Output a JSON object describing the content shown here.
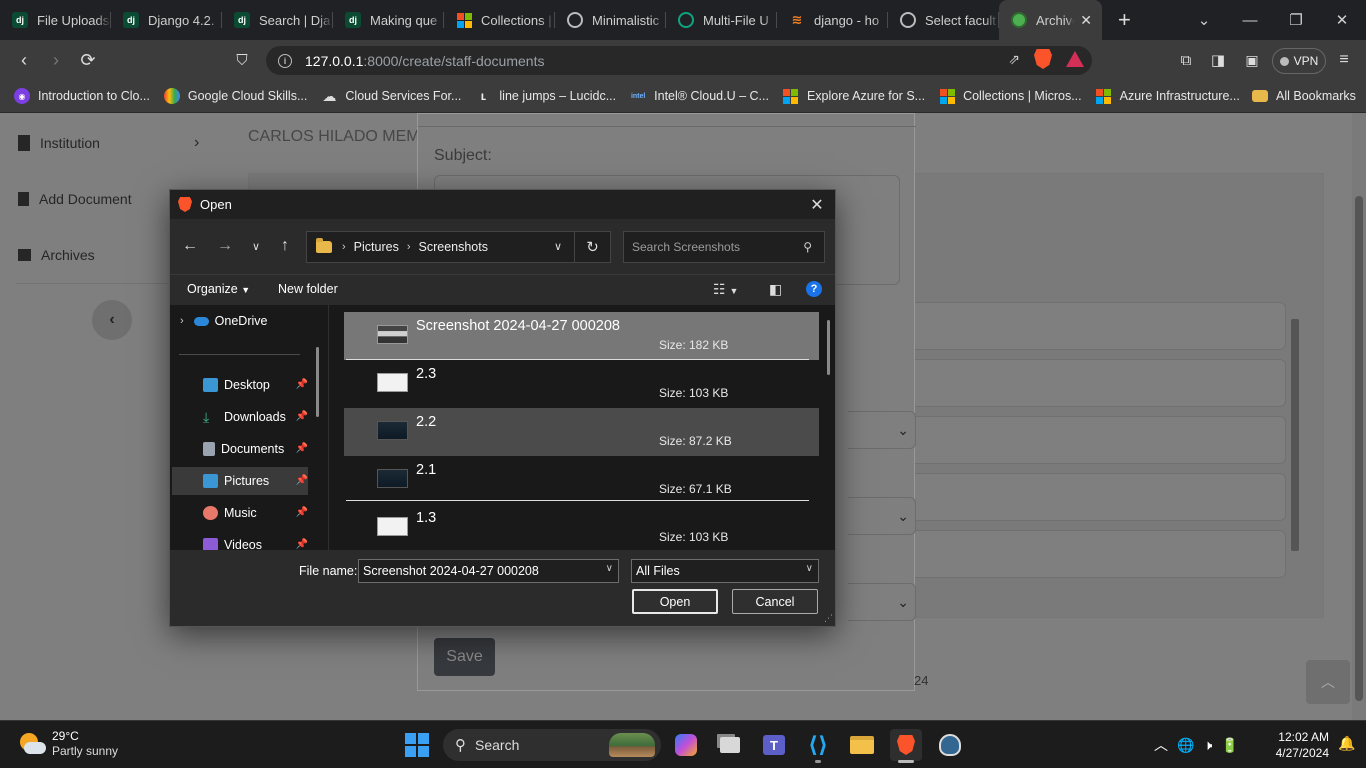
{
  "browser": {
    "tabs": [
      {
        "title": "File Uploads",
        "favicon": "django-icon",
        "color": "#0c4b33"
      },
      {
        "title": "Django 4.2.",
        "favicon": "django-icon",
        "color": "#0c4b33"
      },
      {
        "title": "Search | Dja",
        "favicon": "django-icon",
        "color": "#0c4b33"
      },
      {
        "title": "Making que",
        "favicon": "django-icon",
        "color": "#0c4b33"
      },
      {
        "title": "Collections |",
        "favicon": "microsoft-icon",
        "color": "#f25022"
      },
      {
        "title": "Minimalistic",
        "favicon": "globe-icon",
        "color": "#888888"
      },
      {
        "title": "Multi-File U",
        "favicon": "chatgpt-icon",
        "color": "#10a37f"
      },
      {
        "title": "django - ho",
        "favicon": "stackoverflow-icon",
        "color": "#f48024"
      },
      {
        "title": "Select facult",
        "favicon": "globe-icon",
        "color": "#888888"
      }
    ],
    "active_tab": {
      "title": "Archive",
      "favicon": "app-icon"
    },
    "url_host": "127.0.0.1",
    "url_rest": ":8000/create/staff-documents",
    "vpn_label": "VPN",
    "bookmarks": [
      {
        "label": "Introduction to Clo...",
        "icon": "course-icon",
        "color": "#7b3fe4"
      },
      {
        "label": "Google Cloud Skills...",
        "icon": "google-cloud-icon",
        "color": "#4285f4"
      },
      {
        "label": "Cloud Services For...",
        "icon": "cloud-icon",
        "color": "#555555"
      },
      {
        "label": "line jumps – Lucidc...",
        "icon": "lucid-icon",
        "color": "#3a3a3a"
      },
      {
        "label": "Intel® Cloud.U – C...",
        "icon": "intel-icon",
        "color": "#0071c5"
      },
      {
        "label": "Explore Azure for S...",
        "icon": "microsoft-icon",
        "color": "#f25022"
      },
      {
        "label": "Collections | Micros...",
        "icon": "microsoft-icon",
        "color": "#f25022"
      },
      {
        "label": "Azure Infrastructure...",
        "icon": "microsoft-icon",
        "color": "#f25022"
      }
    ],
    "more_bookmarks": "»",
    "all_bookmarks": "All Bookmarks"
  },
  "page": {
    "sidebar": [
      {
        "label": "Institution",
        "icon": "building-icon"
      },
      {
        "label": "Add Document",
        "icon": "file-icon"
      },
      {
        "label": "Archives",
        "icon": "archive-icon"
      }
    ],
    "heading": "CARLOS HILADO MEM",
    "subject_label": "Subject:",
    "save_label": "Save",
    "year_fragment": "24"
  },
  "dialog": {
    "title": "Open",
    "breadcrumbs": [
      "Pictures",
      "Screenshots"
    ],
    "search_placeholder": "Search Screenshots",
    "organize_label": "Organize",
    "new_folder_label": "New folder",
    "help_label": "?",
    "nav_items": [
      {
        "label": "OneDrive",
        "icon": "onedrive-icon",
        "color": "#2b88d8",
        "pinned": false
      },
      {
        "label": "Desktop",
        "icon": "desktop-icon",
        "color": "#3b97d3",
        "pinned": true
      },
      {
        "label": "Downloads",
        "icon": "download-icon",
        "color": "#3fb68b",
        "pinned": true
      },
      {
        "label": "Documents",
        "icon": "document-icon",
        "color": "#9aa4b1",
        "pinned": true
      },
      {
        "label": "Pictures",
        "icon": "pictures-icon",
        "color": "#3b97d3",
        "pinned": true
      },
      {
        "label": "Music",
        "icon": "music-icon",
        "color": "#e8786a",
        "pinned": true
      },
      {
        "label": "Videos",
        "icon": "videos-icon",
        "color": "#8e5bd6",
        "pinned": true
      }
    ],
    "files": [
      {
        "name": "Screenshot 2024-04-27 000208",
        "size": "Size: 182 KB",
        "state": "selected"
      },
      {
        "name": "2.3",
        "size": "Size: 103 KB",
        "state": ""
      },
      {
        "name": "2.2",
        "size": "Size: 87.2 KB",
        "state": "hover"
      },
      {
        "name": "2.1",
        "size": "Size: 67.1 KB",
        "state": ""
      },
      {
        "name": "1.3",
        "size": "Size: 103 KB",
        "state": ""
      }
    ],
    "file_name_label": "File name:",
    "file_name_value": "Screenshot 2024-04-27 000208",
    "file_type": "All Files",
    "open_label": "Open",
    "cancel_label": "Cancel"
  },
  "taskbar": {
    "temperature": "29°C",
    "weather": "Partly sunny",
    "search_label": "Search",
    "time": "12:02 AM",
    "date": "4/27/2024"
  }
}
